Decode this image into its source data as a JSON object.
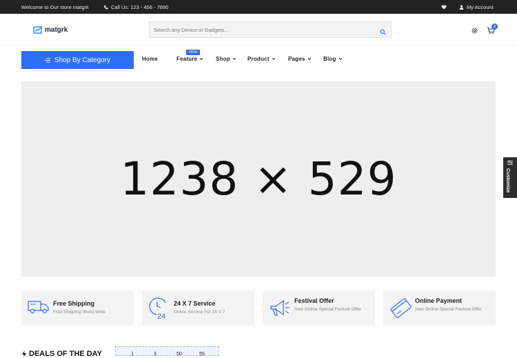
{
  "topbar": {
    "welcome": "Welcome to Our store matgrk",
    "phone": "Call Us: 123 - 456 - 7890",
    "account": "My Account"
  },
  "header": {
    "logo": "matgrk",
    "search_placeholder": "Search any Device or Gadgets...",
    "cart_count": "2"
  },
  "nav": {
    "category_button": "Shop By Category",
    "new_tag": "NEW",
    "items": [
      {
        "label": "Home"
      },
      {
        "label": "Feature"
      },
      {
        "label": "Shop"
      },
      {
        "label": "Product"
      },
      {
        "label": "Pages"
      },
      {
        "label": "Blog"
      }
    ]
  },
  "hero": {
    "placeholder": "1238 × 529"
  },
  "customize": {
    "label": "Customize"
  },
  "features": [
    {
      "icon": "truck-icon",
      "title": "Free Shipping",
      "subtitle": "Free Shipping World Wide"
    },
    {
      "icon": "clock-24-icon",
      "title": "24 X 7 Service",
      "subtitle": "Online Service For 24 X 7"
    },
    {
      "icon": "megaphone-icon",
      "title": "Festival Offer",
      "subtitle": "New Online Special Festival Offer"
    },
    {
      "icon": "credit-card-icon",
      "title": "Online Payment",
      "subtitle": "New Online Special Festival Offer"
    }
  ],
  "deals": {
    "title": "DEALS OF THE DAY",
    "timer": [
      "1",
      "3",
      "50",
      "55"
    ]
  },
  "colors": {
    "accent": "#2b6ff5",
    "topbar": "#222222",
    "hero_bg": "#eeeeee"
  }
}
